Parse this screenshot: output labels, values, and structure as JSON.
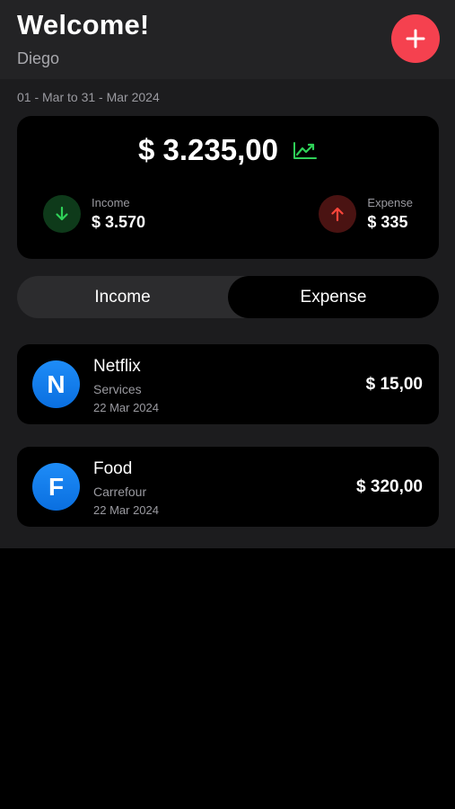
{
  "header": {
    "title": "Welcome!",
    "user_name": "Diego",
    "add_button_icon": "plus-icon",
    "accent_color": "#f5414f"
  },
  "summary": {
    "date_range": "01 - Mar to 31 - Mar 2024",
    "balance": "$ 3.235,00",
    "trend_icon": "trending-up-icon",
    "income": {
      "label": "Income",
      "value": "$ 3.570",
      "icon": "arrow-down-icon",
      "color": "#2fd158"
    },
    "expense": {
      "label": "Expense",
      "value": "$ 335",
      "icon": "arrow-up-icon",
      "color": "#ff453a"
    }
  },
  "toggle": {
    "options": [
      "Income",
      "Expense"
    ],
    "selected": "Expense"
  },
  "transactions": [
    {
      "initial": "N",
      "title": "Netflix",
      "category": "Services",
      "date": "22 Mar 2024",
      "amount": "$ 15,00"
    },
    {
      "initial": "F",
      "title": "Food",
      "category": "Carrefour",
      "date": "22 Mar 2024",
      "amount": "$ 320,00"
    }
  ]
}
